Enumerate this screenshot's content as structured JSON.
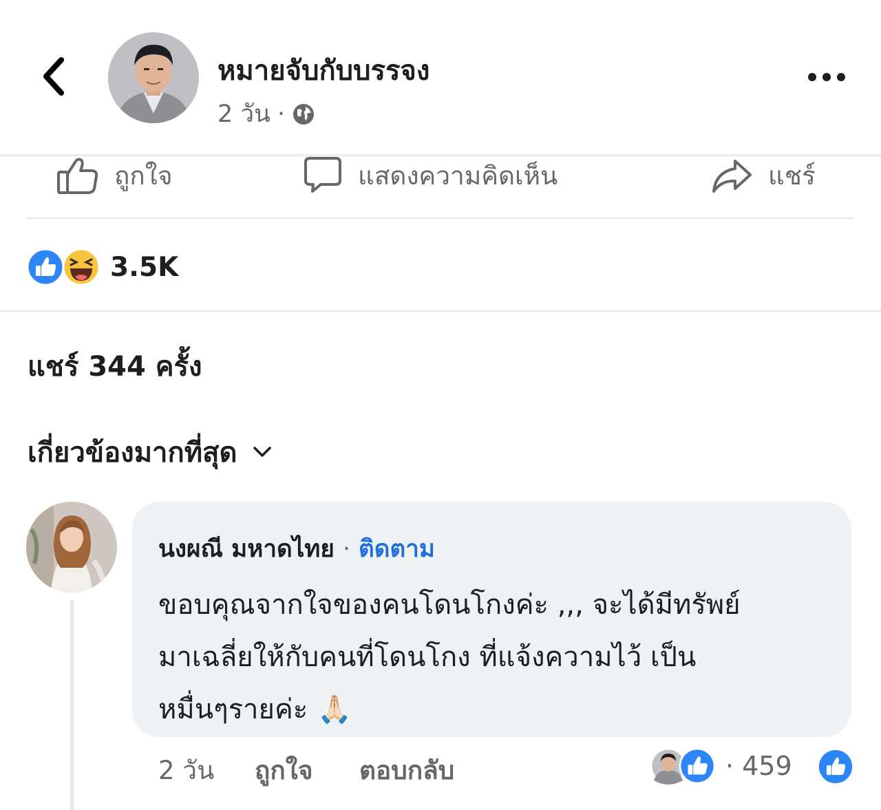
{
  "post": {
    "page_name": "หมายจับกับบรรจง",
    "time": "2 วัน",
    "separator": "·",
    "privacy_icon": "globe-icon",
    "more_icon": "more-icon"
  },
  "actions": {
    "like_label": "ถูกใจ",
    "comment_label": "แสดงความคิดเห็น",
    "share_label": "แชร์"
  },
  "reactions": {
    "types": [
      "like",
      "haha"
    ],
    "count": "3.5K"
  },
  "shares_text": "แชร์ 344 ครั้ง",
  "sort_label": "เกี่ยวข้องมากที่สุด",
  "comment": {
    "author": "นงผณี มหาดไทย",
    "separator": "·",
    "follow_label": "ติดตาม",
    "lines": [
      "ขอบคุณจากใจของคนโดนโกงค่ะ ,,, จะได้มีทรัพย์",
      "มาเฉลี่ยให้กับคนที่โดนโกง ที่แจ้งความไว้ เป็น",
      "หมื่นๆรายค่ะ"
    ],
    "emoji": "🙏🏻",
    "time": "2 วัน",
    "like_label": "ถูกใจ",
    "reply_label": "ตอบกลับ",
    "reaction_separator": "·",
    "reaction_count": "459"
  },
  "colors": {
    "facebook_blue": "#216fdb",
    "secondary_text": "#65676b",
    "bubble": "#eff2f5"
  }
}
